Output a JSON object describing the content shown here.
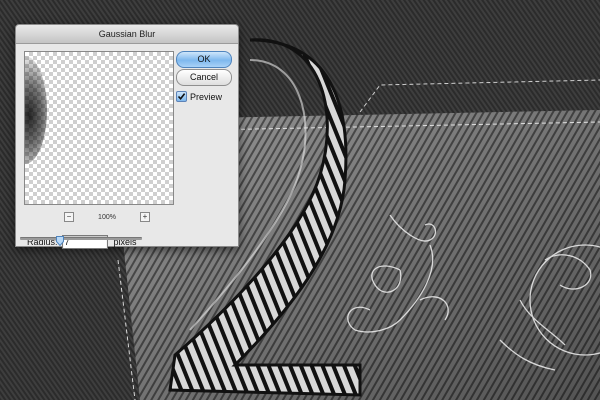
{
  "dialog": {
    "title": "Gaussian Blur",
    "ok_label": "OK",
    "cancel_label": "Cancel",
    "preview_label": "Preview",
    "preview_checked": true,
    "zoom_level": "100%",
    "zoom_out_label": "−",
    "zoom_in_label": "+",
    "radius_label": "Radius:",
    "radius_value": "7",
    "radius_unit": "pixels",
    "radius_slider_fraction": 0.33
  },
  "colors": {
    "ok_button": "#7eb8ee",
    "dialog_bg": "#e8e8e8",
    "canvas_dark": "#2a2a2a"
  },
  "icons": {
    "zoom_out": "minus-icon",
    "zoom_in": "plus-icon",
    "preview_check": "checkmark-icon",
    "slider_thumb": "slider-triangle-icon"
  }
}
